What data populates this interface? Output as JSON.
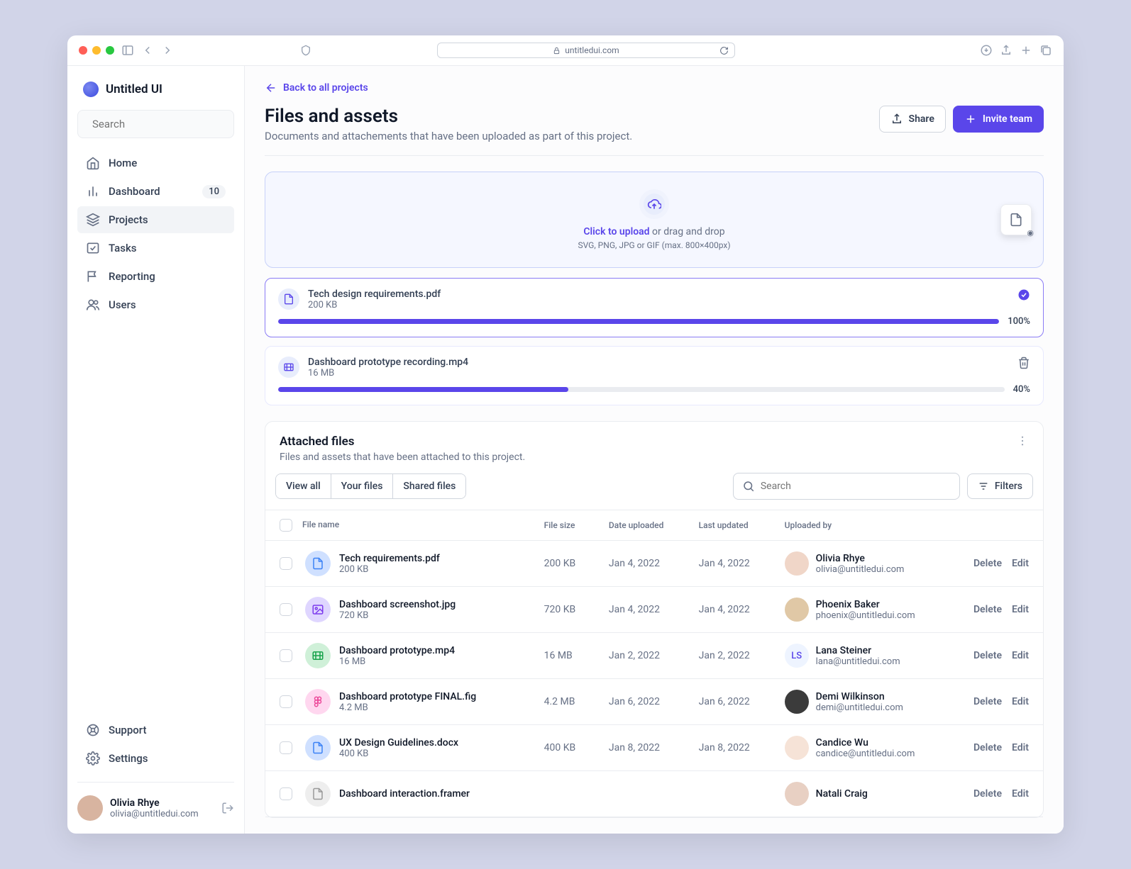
{
  "chrome": {
    "url": "untitledui.com"
  },
  "brand": "Untitled UI",
  "search_placeholder": "Search",
  "nav": [
    {
      "icon": "home",
      "label": "Home"
    },
    {
      "icon": "bar",
      "label": "Dashboard",
      "badge": "10"
    },
    {
      "icon": "layers",
      "label": "Projects",
      "active": true
    },
    {
      "icon": "check",
      "label": "Tasks"
    },
    {
      "icon": "flag",
      "label": "Reporting"
    },
    {
      "icon": "users",
      "label": "Users"
    }
  ],
  "nav_bottom": [
    {
      "icon": "life",
      "label": "Support"
    },
    {
      "icon": "cog",
      "label": "Settings"
    }
  ],
  "user": {
    "name": "Olivia Rhye",
    "email": "olivia@untitledui.com"
  },
  "back_label": "Back to all projects",
  "page_title": "Files and assets",
  "page_subtitle": "Documents and attachements that have been uploaded as part of this project.",
  "share_label": "Share",
  "invite_label": "Invite team",
  "upload": {
    "click": "Click to upload",
    "rest": "or drag and drop",
    "sub": "SVG, PNG, JPG or GIF (max. 800×400px)"
  },
  "uploads": [
    {
      "name": "Tech design requirements.pdf",
      "size": "200 KB",
      "pct": 100,
      "done": true,
      "doc": true
    },
    {
      "name": "Dashboard prototype recording.mp4",
      "size": "16 MB",
      "pct": 40,
      "done": false,
      "doc": false
    }
  ],
  "attached": {
    "title": "Attached files",
    "subtitle": "Files and assets that have been attached to this project.",
    "tabs": [
      "View all",
      "Your files",
      "Shared files"
    ],
    "search_placeholder": "Search",
    "filters": "Filters",
    "cols": {
      "name": "File name",
      "size": "File size",
      "uploaded": "Date uploaded",
      "updated": "Last updated",
      "by": "Uploaded by"
    },
    "delete": "Delete",
    "edit": "Edit",
    "rows": [
      {
        "icon": "doc",
        "color": "#cfe0ff",
        "fg": "#3b82f6",
        "name": "Tech requirements.pdf",
        "size": "200 KB",
        "size2": "200 KB",
        "uploaded": "Jan 4, 2022",
        "updated": "Jan 4, 2022",
        "user": {
          "name": "Olivia Rhye",
          "email": "olivia@untitledui.com",
          "av_bg": "#f0d6c8",
          "av_txt": ""
        }
      },
      {
        "icon": "img",
        "color": "#dfd6ff",
        "fg": "#7c3aed",
        "name": "Dashboard screenshot.jpg",
        "size": "720 KB",
        "size2": "720 KB",
        "uploaded": "Jan 4, 2022",
        "updated": "Jan 4, 2022",
        "user": {
          "name": "Phoenix Baker",
          "email": "phoenix@untitledui.com",
          "av_bg": "#e0c8a6",
          "av_txt": ""
        }
      },
      {
        "icon": "vid",
        "color": "#cff0d8",
        "fg": "#16a34a",
        "name": "Dashboard prototype.mp4",
        "size": "16 MB",
        "size2": "16 MB",
        "uploaded": "Jan 2, 2022",
        "updated": "Jan 2, 2022",
        "user": {
          "name": "Lana Steiner",
          "email": "lana@untitledui.com",
          "av_bg": "#eef4ff",
          "av_txt": "LS",
          "av_fg": "#5a46ea"
        }
      },
      {
        "icon": "fig",
        "color": "#ffd7ef",
        "fg": "#ec4899",
        "name": "Dashboard prototype FINAL.fig",
        "size": "4.2 MB",
        "size2": "4.2 MB",
        "uploaded": "Jan 6, 2022",
        "updated": "Jan 6, 2022",
        "user": {
          "name": "Demi Wilkinson",
          "email": "demi@untitledui.com",
          "av_bg": "#3b3b3b",
          "av_txt": ""
        }
      },
      {
        "icon": "doc",
        "color": "#cfe0ff",
        "fg": "#3b82f6",
        "name": "UX Design Guidelines.docx",
        "size": "400 KB",
        "size2": "400 KB",
        "uploaded": "Jan 8, 2022",
        "updated": "Jan 8, 2022",
        "user": {
          "name": "Candice Wu",
          "email": "candice@untitledui.com",
          "av_bg": "#f6e3d7",
          "av_txt": ""
        }
      },
      {
        "icon": "doc",
        "color": "#eee",
        "fg": "#999",
        "name": "Dashboard interaction.framer",
        "size": "",
        "size2": "",
        "uploaded": "",
        "updated": "",
        "user": {
          "name": "Natali Craig",
          "email": "",
          "av_bg": "#e8d0c3",
          "av_txt": ""
        }
      }
    ]
  }
}
